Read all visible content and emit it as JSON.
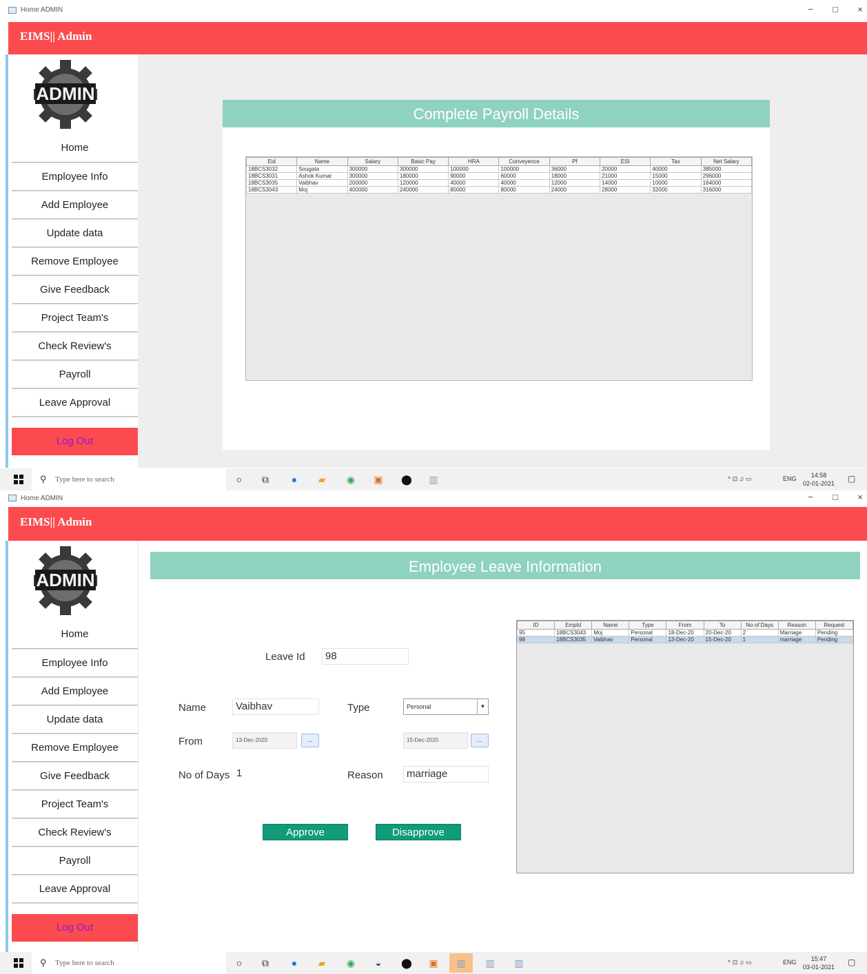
{
  "window": {
    "title": "Home ADMIN",
    "min": "−",
    "max": "□",
    "close": "×"
  },
  "brand": "EIMS|| Admin",
  "logo_text": "ADMIN",
  "sidebar": {
    "items": [
      {
        "label": "Home"
      },
      {
        "label": "Employee Info"
      },
      {
        "label": "Add Employee"
      },
      {
        "label": "Update data"
      },
      {
        "label": "Remove Employee"
      },
      {
        "label": "Give Feedback"
      },
      {
        "label": "Project Team's"
      },
      {
        "label": "Check Review's"
      },
      {
        "label": "Payroll"
      },
      {
        "label": "Leave Approval"
      }
    ],
    "logout": "Log Out"
  },
  "payroll": {
    "title": "Complete Payroll Details",
    "columns": [
      "Eid",
      "Name",
      "Salary",
      "Basic Pay",
      "HRA",
      "Conveyence",
      "Pf",
      "ESI",
      "Tax",
      "Net Salary"
    ],
    "rows": [
      [
        "18BCS3032",
        "Sougata",
        "300000",
        "300000",
        "100000",
        "100000",
        "36000",
        "20000",
        "40000",
        "385000"
      ],
      [
        "18BCS3031",
        "Ashok Kumar",
        "300000",
        "180000",
        "90000",
        "60000",
        "18000",
        "21000",
        "15000",
        "296000"
      ],
      [
        "18BCS3035",
        "Vaibhav",
        "200000",
        "120000",
        "40000",
        "40000",
        "12000",
        "14000",
        "10000",
        "164000"
      ],
      [
        "18BCS3043",
        "Moj",
        "400000",
        "240000",
        "80000",
        "80000",
        "24000",
        "28000",
        "32000",
        "316000"
      ]
    ]
  },
  "leave": {
    "title": "Employee Leave Information",
    "labels": {
      "leave_id": "Leave Id",
      "name": "Name",
      "type": "Type",
      "from": "From",
      "days": "No of Days",
      "reason": "Reason"
    },
    "values": {
      "leave_id": "98",
      "name": "Vaibhav",
      "type": "Personal",
      "from": "13-Dec-2020",
      "to": "15-Dec-2020",
      "days": "1",
      "reason": "marriage"
    },
    "date_btn": "...",
    "approve": "Approve",
    "disapprove": "Disapprove",
    "columns": [
      "ID",
      "EmpId",
      "Name",
      "Type",
      "From",
      "To",
      "No of Days",
      "Reason",
      "Request"
    ],
    "rows": [
      [
        "95",
        "18BCS3043",
        "Moj",
        "Personal",
        "18-Dec-20",
        "20-Dec-20",
        "2",
        "Marriage",
        "Pending"
      ],
      [
        "98",
        "18BCS3035",
        "Vaibhav",
        "Personal",
        "13-Dec-20",
        "15-Dec-20",
        "1",
        "marriage",
        "Pending"
      ]
    ]
  },
  "taskbar": {
    "search_placeholder": "Type here to search",
    "tray_lang": "ENG",
    "s1_time": "14:58",
    "s1_date": "02-01-2021",
    "s2_time": "15:47",
    "s2_date": "03-01-2021"
  }
}
